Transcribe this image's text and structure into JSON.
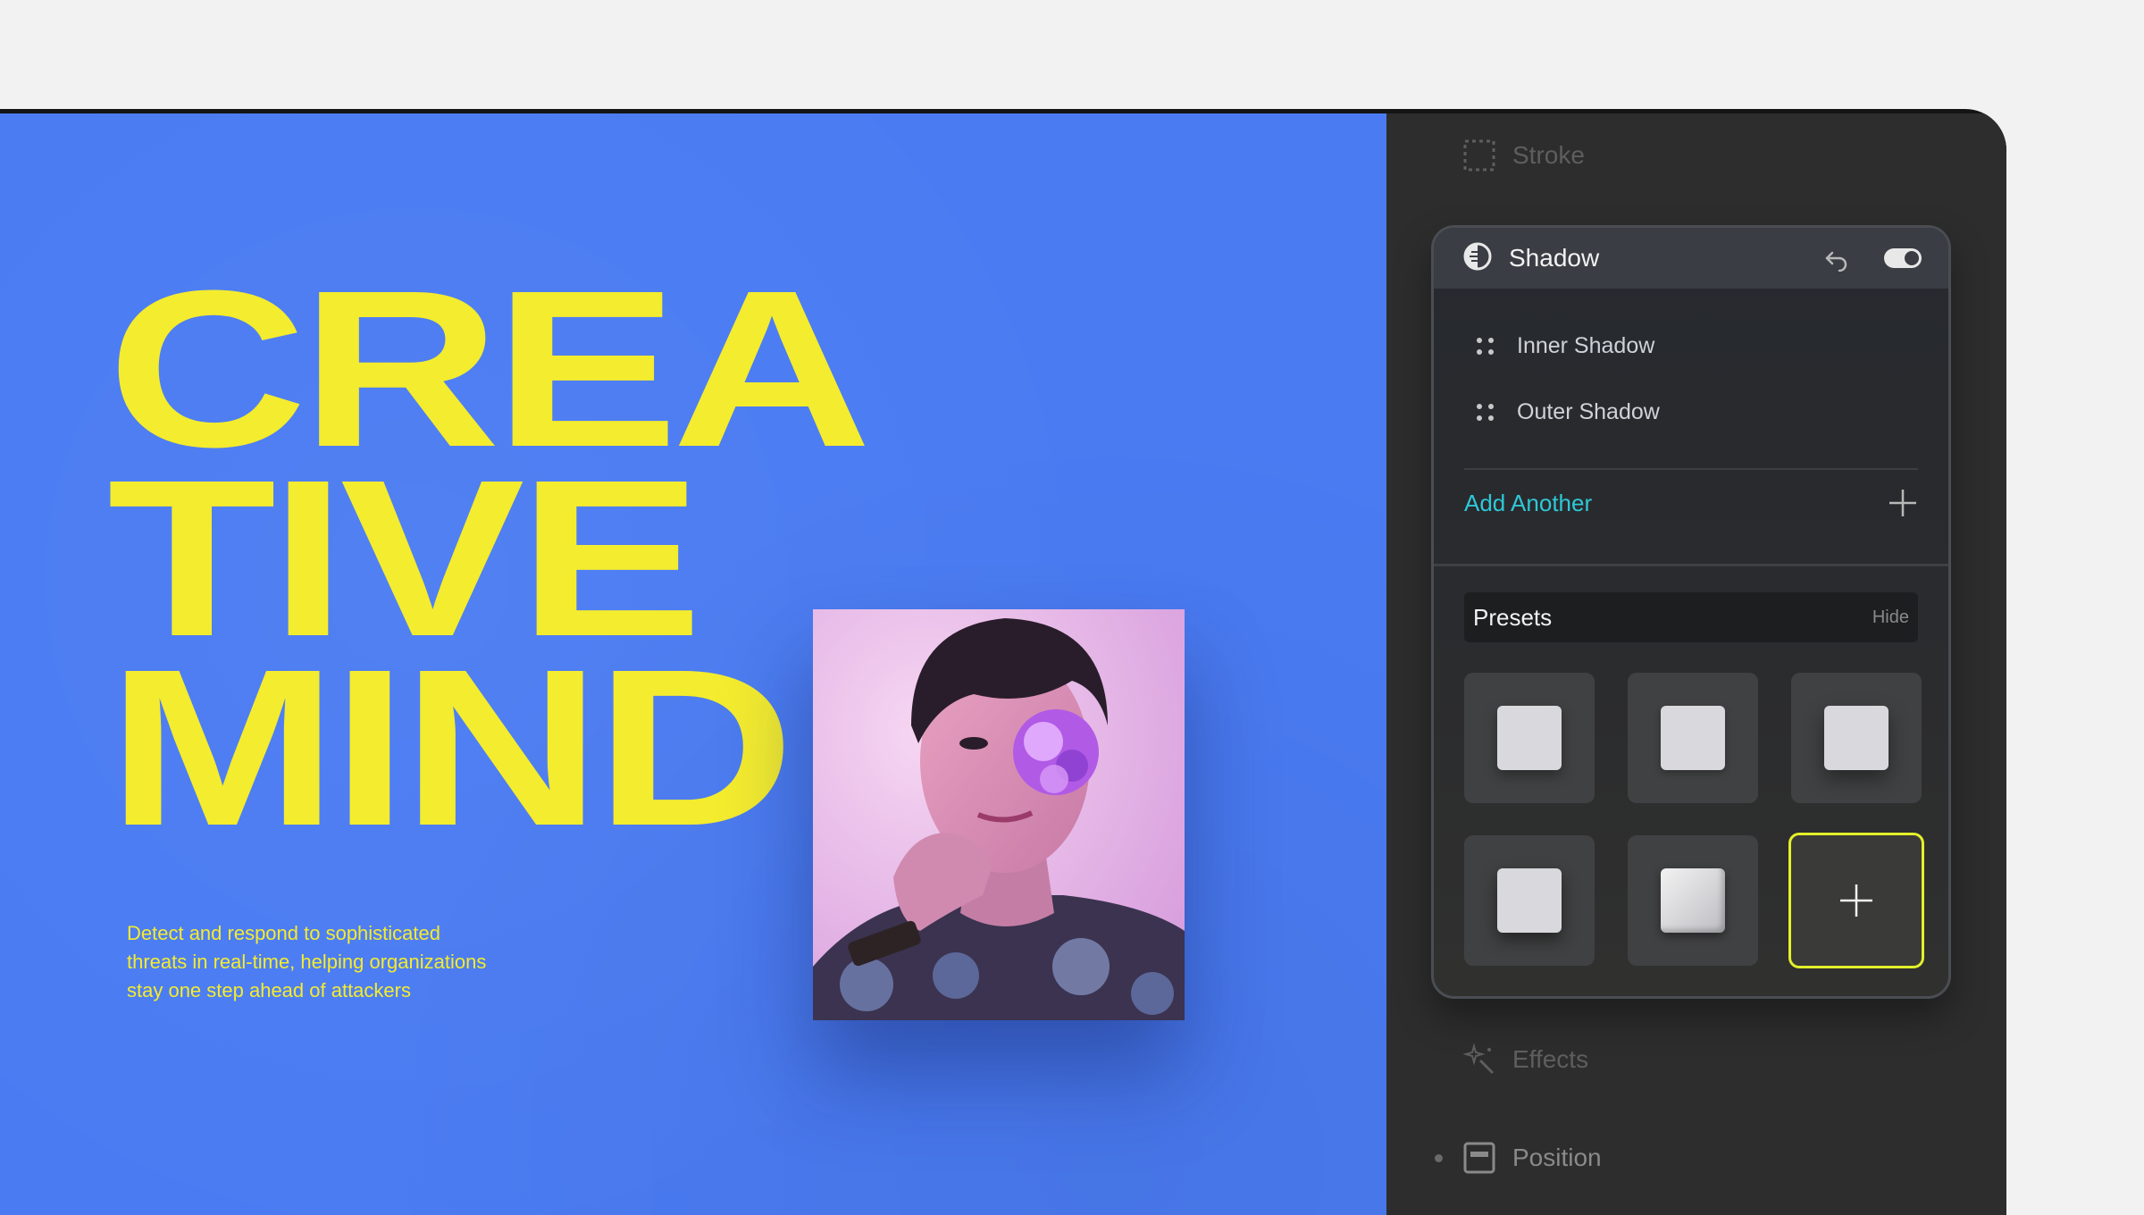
{
  "canvas": {
    "headline_lines": [
      "CREA",
      "TIVE",
      "MIND"
    ],
    "tagline": "Detect and respond to sophisticated threats in real-time, helping organizations stay one step ahead of attackers"
  },
  "panel": {
    "stroke_label": "Stroke",
    "shadow": {
      "title": "Shadow",
      "toggle_on": true,
      "items": [
        {
          "label": "Inner Shadow"
        },
        {
          "label": "Outer Shadow"
        }
      ],
      "add_label": "Add Another",
      "presets_title": "Presets",
      "presets_hide": "Hide",
      "presets": [
        {
          "style": "soft"
        },
        {
          "style": "soft-small"
        },
        {
          "style": "soft-large"
        },
        {
          "style": "outer"
        },
        {
          "style": "bevel"
        }
      ]
    },
    "effects_label": "Effects",
    "position_label": "Position"
  },
  "colors": {
    "canvas_bg": "#4a7bf2",
    "headline": "#f4ec2e",
    "panel_bg": "#2d2d2d",
    "accent_link": "#2ec8d6",
    "add_tile_border": "#e3f02a"
  }
}
